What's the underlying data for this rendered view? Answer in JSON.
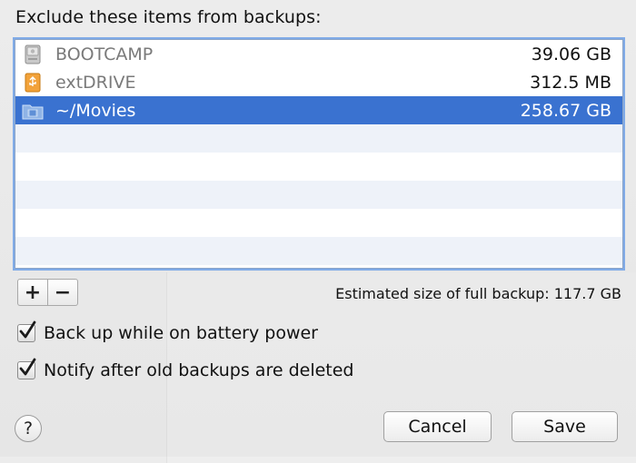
{
  "dialog": {
    "title": "Exclude these items from backups:"
  },
  "exclusions": [
    {
      "name": "BOOTCAMP",
      "size": "39.06 GB",
      "icon": "hard-drive-icon",
      "selected": false,
      "dimmed": true
    },
    {
      "name": "extDRIVE",
      "size": "312.5 MB",
      "icon": "usb-drive-icon",
      "selected": false,
      "dimmed": true
    },
    {
      "name": "~/Movies",
      "size": "258.67 GB",
      "icon": "movies-folder-icon",
      "selected": true,
      "dimmed": false
    }
  ],
  "list_controls": {
    "add": "+",
    "remove": "−"
  },
  "estimate": {
    "text": "Estimated size of full backup: 117.7 GB"
  },
  "options": {
    "battery": {
      "label": "Back up while on battery power",
      "checked": true
    },
    "notify": {
      "label": "Notify after old backups are deleted",
      "checked": true
    }
  },
  "footer": {
    "help": "?",
    "cancel": "Cancel",
    "save": "Save"
  },
  "colors": {
    "selection": "#3a72d0",
    "focus_ring": "#6ea0e6",
    "alt_row": "#eef2f9"
  }
}
